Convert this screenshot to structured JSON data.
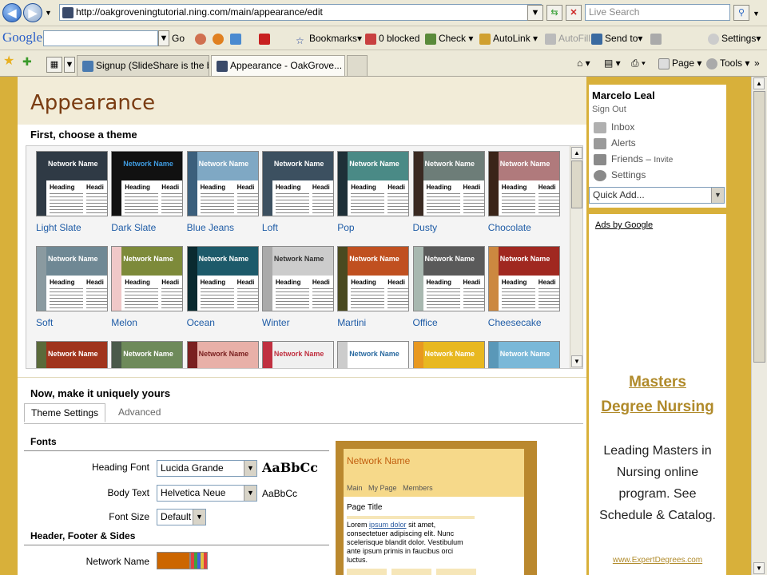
{
  "browser": {
    "url": "http://oakgroveningtutorial.ning.com/main/appearance/edit",
    "search_placeholder": "Live Search",
    "google_logo": "Google",
    "google_go": "Go",
    "toolbar": {
      "bookmarks": "Bookmarks",
      "blocked": "0 blocked",
      "check": "Check",
      "autolink": "AutoLink",
      "autofill": "AutoFill",
      "sendto": "Send to",
      "settings": "Settings"
    },
    "tabs": [
      {
        "label": "Signup (SlideShare is the bes..."
      },
      {
        "label": "Appearance - OakGrove..."
      }
    ],
    "right_tools": {
      "page": "Page",
      "tools": "Tools"
    }
  },
  "page": {
    "title": "Appearance",
    "choose_theme": "First, choose a theme",
    "make_yours": "Now, make it uniquely yours",
    "tab_theme": "Theme Settings",
    "tab_advanced": "Advanced",
    "fonts_heading": "Fonts",
    "heading_font_label": "Heading Font",
    "heading_font_value": "Lucida Grande",
    "body_text_label": "Body Text",
    "body_text_value": "Helvetica Neue",
    "font_size_label": "Font Size",
    "font_size_value": "Default",
    "sample": "AaBbCc",
    "hfs_heading": "Header, Footer & Sides",
    "network_name_label": "Network Name",
    "network_name_color": "#cc6600"
  },
  "theme_thumb": {
    "name": "Network Name",
    "heading": "Heading",
    "heading2": "Headi"
  },
  "themes": [
    {
      "label": "Light Slate",
      "top": "#2f3a45",
      "side": "#2f3a45",
      "name_color": "#ffffff"
    },
    {
      "label": "Dark Slate",
      "top": "#111111",
      "side": "#111111",
      "name_color": "#3f9be0"
    },
    {
      "label": "Blue Jeans",
      "top": "#7fa8c4",
      "side": "#3b5f7c",
      "name_color": "#ffffff"
    },
    {
      "label": "Loft",
      "top": "#3c5060",
      "side": "#3c5060",
      "name_color": "#ffffff"
    },
    {
      "label": "Pop",
      "top": "#4a8a86",
      "side": "#1e3038",
      "name_color": "#ffffff"
    },
    {
      "label": "Dusty",
      "top": "#6d7d78",
      "side": "#3a2a22",
      "name_color": "#ffffff"
    },
    {
      "label": "Chocolate",
      "top": "#b07a7c",
      "side": "#3a2418",
      "name_color": "#ffffff"
    },
    {
      "label": "Soft",
      "top": "#6f8894",
      "side": "#8a9aa0",
      "name_color": "#ffffff"
    },
    {
      "label": "Melon",
      "top": "#7d8a3a",
      "side": "#f0c8c8",
      "name_color": "#ffffff"
    },
    {
      "label": "Ocean",
      "top": "#1d5a6a",
      "side": "#0a2a30",
      "name_color": "#ffffff"
    },
    {
      "label": "Winter",
      "top": "#cccccc",
      "side": "#aaaaaa",
      "name_color": "#333333"
    },
    {
      "label": "Martini",
      "top": "#c05020",
      "side": "#4a4a20",
      "name_color": "#ffffff"
    },
    {
      "label": "Office",
      "top": "#5a5a5a",
      "side": "#a8b8b0",
      "name_color": "#ffffff"
    },
    {
      "label": "Cheesecake",
      "top": "#a02820",
      "side": "#cc8840",
      "name_color": "#ffffff"
    },
    {
      "label": "",
      "top": "#a0341c",
      "side": "#5a6a3a",
      "name_color": "#ffffff"
    },
    {
      "label": "",
      "top": "#6e8a5a",
      "side": "#4a5a4a",
      "name_color": "#ffffff"
    },
    {
      "label": "",
      "top": "#e8b0a8",
      "side": "#7a2020",
      "name_color": "#7a2020"
    },
    {
      "label": "",
      "top": "#f0f0f0",
      "side": "#c03040",
      "name_color": "#c03040"
    },
    {
      "label": "",
      "top": "#ffffff",
      "side": "#cccccc",
      "name_color": "#2a6aa0"
    },
    {
      "label": "",
      "top": "#e8b820",
      "side": "#e89820",
      "name_color": "#ffffff"
    },
    {
      "label": "",
      "top": "#7ab8d8",
      "side": "#5a98b8",
      "name_color": "#ffffff"
    }
  ],
  "preview": {
    "network_name": "Network Name",
    "nav": [
      "Main",
      "My Page",
      "Members"
    ],
    "page_title": "Page Title",
    "lorem_pre": "Lorem",
    "lorem_link": "ipsum dolor",
    "lorem_post": "sit amet, consectetuer adipiscing elit. Nunc scelerisque blandit dolor. Vestibulum ante ipsum primis in faucibus orci luctus."
  },
  "sidebar": {
    "user": "Marcelo Leal",
    "sign_out": "Sign Out",
    "inbox": "Inbox",
    "alerts": "Alerts",
    "friends": "Friends",
    "invite": "Invite",
    "settings": "Settings",
    "quick_add": "Quick Add...",
    "ads_by_google": "Ads by Google",
    "ad_title_1": "Masters",
    "ad_title_2": "Degree Nursing",
    "ad_body_1": "Leading Masters in",
    "ad_body_2": "Nursing online",
    "ad_body_3": "program. See",
    "ad_body_4": "Schedule & Catalog.",
    "ad_url": "www.ExpertDegrees.com"
  }
}
